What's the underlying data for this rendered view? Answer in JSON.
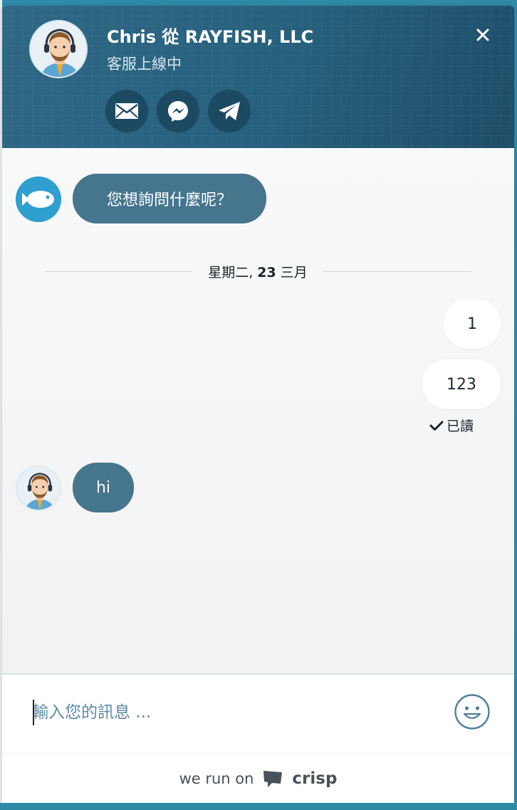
{
  "header": {
    "agent_name": "Chris 從 RAYFISH, LLC",
    "status": "客服上線中",
    "channels": [
      {
        "icon": "email-icon"
      },
      {
        "icon": "messenger-icon"
      },
      {
        "icon": "telegram-icon"
      }
    ],
    "close_icon": "close-icon"
  },
  "messages": [
    {
      "from": "operator",
      "avatar": "fish-logo",
      "text": "您想詢問什麼呢？"
    },
    {
      "type": "date",
      "prefix": "星期二,",
      "day": "23",
      "month": "三月"
    },
    {
      "from": "me",
      "text": "1"
    },
    {
      "from": "me",
      "text": "123"
    },
    {
      "type": "receipt",
      "text": "已讀"
    },
    {
      "from": "operator",
      "avatar": "agent-photo",
      "text": "hi"
    }
  ],
  "compose": {
    "placeholder": "輸入您的訊息 ...",
    "value": "",
    "emoji_icon": "smiley-icon"
  },
  "footer": {
    "powered_text": "we run on",
    "brand": "crisp"
  },
  "colors": {
    "header_bg": "#26607c",
    "operator_bubble": "#46758e",
    "user_bubble": "#ffffff",
    "accent": "#2f9fd0"
  }
}
